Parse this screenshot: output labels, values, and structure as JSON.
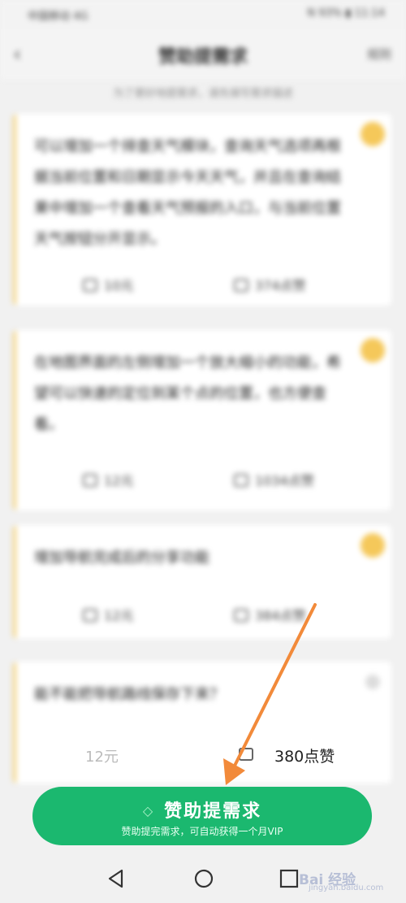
{
  "status_bar": {
    "left": "中国移动 4G",
    "right": "N 93% ▮ 11:14"
  },
  "nav": {
    "back_label": "‹",
    "title": "赞助提需求",
    "right_label": "规则"
  },
  "tip": "为了更好地提需求，请先填写需求描述",
  "cards": [
    {
      "text": "可以增加一个排查天气模块，查询天气选项再根据当前位置和日期显示今天天气，并且在查询结果中增加一个查看天气预报的入口，与当前位置天气按钮分开显示。",
      "meta_left": "10元",
      "meta_right": "374点赞"
    },
    {
      "text": "在地图界面的左侧增加一个放大缩小的功能，希望可以快速的定位到某个点的位置，也方便查看。",
      "meta_left": "12元",
      "meta_right": "1034点赞"
    },
    {
      "text": "增加导航完成后的分享功能",
      "meta_left": "12元",
      "meta_right": "384点赞"
    },
    {
      "text": "能不能把导航路线保存下来？",
      "meta_left": "12元",
      "meta_right": "380点赞"
    }
  ],
  "cta": {
    "gem_icon": "◇",
    "title": "赞助提需求",
    "subtitle": "赞助提完需求，可自动获得一个月VIP",
    "color": "#1bb86f"
  },
  "watermark": {
    "text": "Bai 经验",
    "sub": "jingyan.baidu.com"
  },
  "colors": {
    "accent": "#1bb86f",
    "badge": "#f5c85a",
    "annotation_arrow": "#f28a3a"
  }
}
